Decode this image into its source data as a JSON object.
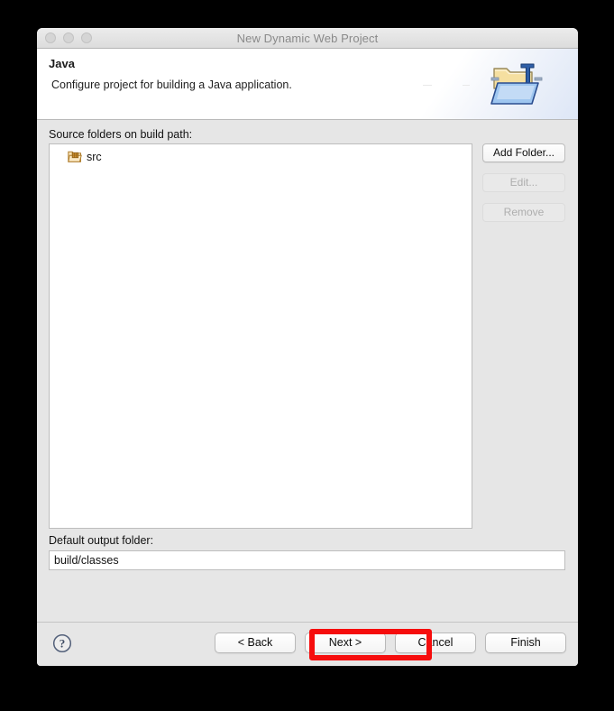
{
  "window": {
    "title": "New Dynamic Web Project",
    "traffic_lights": [
      "close-button",
      "minimize-button",
      "zoom-button"
    ]
  },
  "header": {
    "title": "Java",
    "description": "Configure project for building a Java application.",
    "icon": "java-project-folder-icon"
  },
  "body": {
    "source_label": "Source folders on build path:",
    "source_folders": [
      {
        "name": "src",
        "icon": "source-folder-icon"
      }
    ],
    "side_buttons": [
      {
        "label": "Add Folder...",
        "name": "add-folder-button",
        "enabled": true
      },
      {
        "label": "Edit...",
        "name": "edit-button",
        "enabled": false
      },
      {
        "label": "Remove",
        "name": "remove-button",
        "enabled": false
      }
    ],
    "output_label": "Default output folder:",
    "output_value": "build/classes",
    "output_placeholder": ""
  },
  "footer": {
    "help_icon": "help-question-icon",
    "buttons": [
      {
        "label": "< Back",
        "name": "back-button"
      },
      {
        "label": "Next >",
        "name": "next-button"
      },
      {
        "label": "Cancel",
        "name": "cancel-button"
      },
      {
        "label": "Finish",
        "name": "finish-button"
      }
    ]
  },
  "annotation": {
    "target": "Next >",
    "color": "#f60d0d"
  }
}
